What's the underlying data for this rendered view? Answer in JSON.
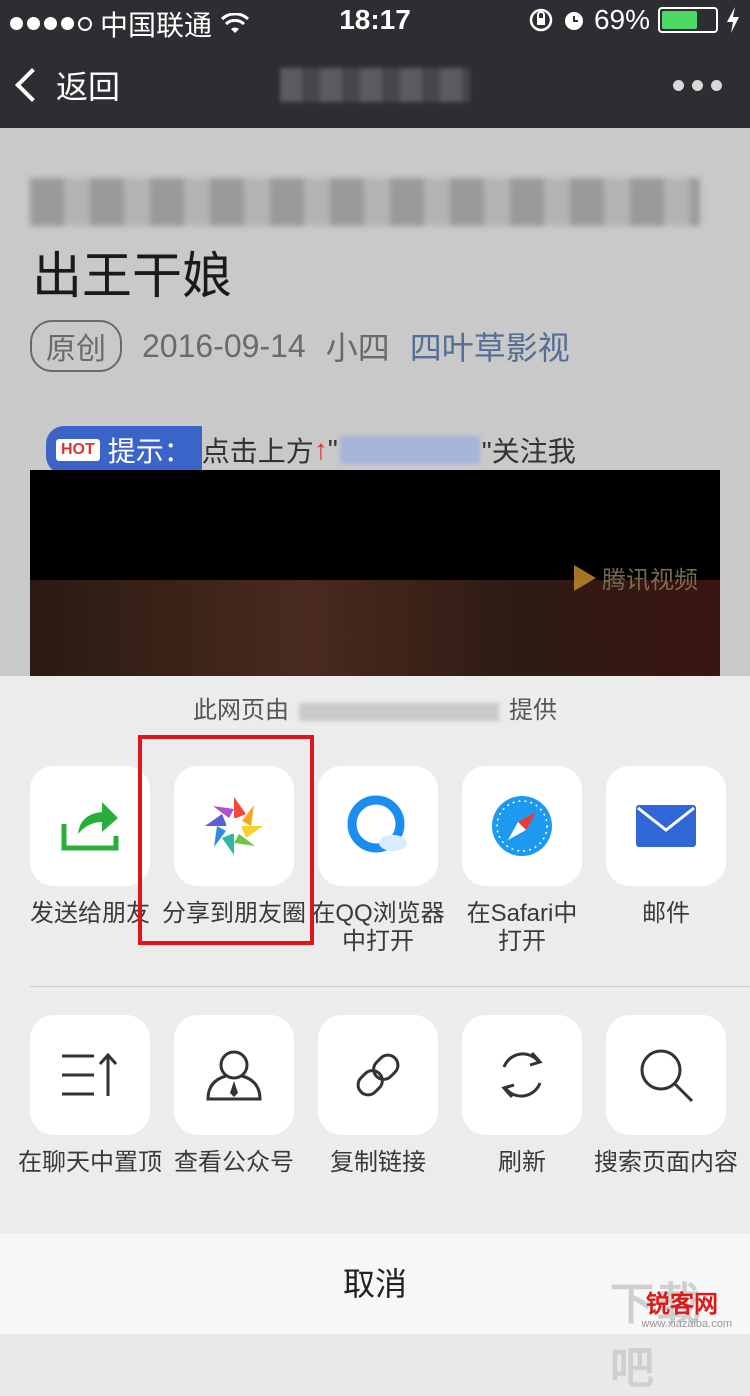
{
  "status_bar": {
    "carrier": "中国联通",
    "time": "18:17",
    "battery": "69%"
  },
  "nav": {
    "back_label": "返回"
  },
  "article": {
    "title_line2": "出王干娘",
    "badge": "原创",
    "date": "2016-09-14",
    "author": "小四",
    "account": "四叶草影视",
    "hint_tag": "HOT",
    "hint_label": "提示：",
    "hint_text_before": "点击上方",
    "hint_arrow": "↑",
    "hint_quote_open": "\"",
    "hint_text_after": "\"关注我",
    "video_watermark": "腾讯视频"
  },
  "sheet": {
    "provider_before": "此网页由",
    "provider_after": "提供",
    "row1": [
      {
        "label": "发送给朋友",
        "icon": "share-forward-icon"
      },
      {
        "label": "分享到朋友圈",
        "icon": "moments-icon"
      },
      {
        "label_line1": "在QQ浏览器",
        "label_line2": "中打开",
        "icon": "qq-browser-icon"
      },
      {
        "label_line1": "在Safari中",
        "label_line2": "打开",
        "icon": "safari-icon"
      },
      {
        "label": "邮件",
        "icon": "mail-icon"
      }
    ],
    "row2": [
      {
        "label": "在聊天中置顶",
        "icon": "pin-top-icon"
      },
      {
        "label": "查看公众号",
        "icon": "official-account-icon"
      },
      {
        "label": "复制链接",
        "icon": "link-icon"
      },
      {
        "label": "刷新",
        "icon": "refresh-icon"
      },
      {
        "label": "搜索页面内容",
        "icon": "search-icon"
      }
    ],
    "cancel": "取消"
  },
  "watermark": {
    "big": "下载吧",
    "small": "锐客网",
    "url": "www.xiazaiba.com"
  }
}
